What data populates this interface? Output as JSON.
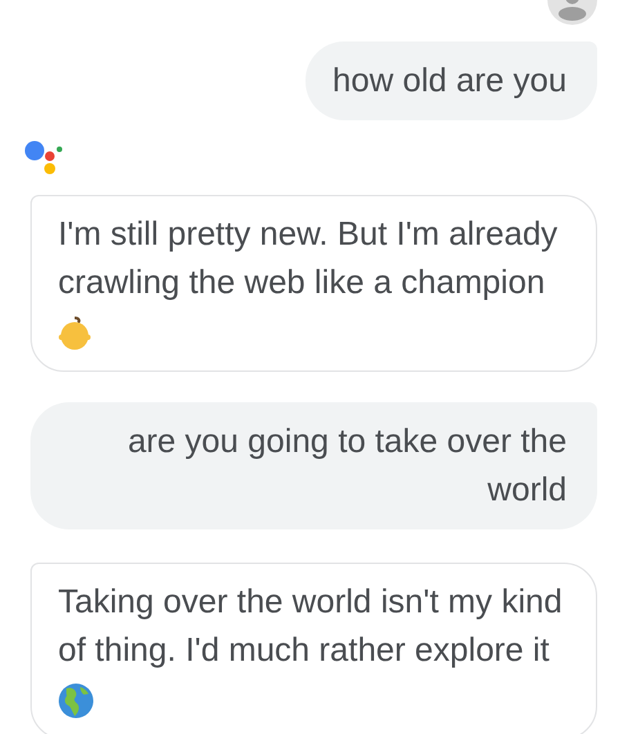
{
  "messages": [
    {
      "kind": "user",
      "text": "how old are you"
    },
    {
      "kind": "assistant",
      "text": "I'm still pretty new. But I'm already crawling the web like a champion"
    },
    {
      "kind": "user",
      "text": "are you going to take over the world"
    },
    {
      "kind": "assistant",
      "text": "Taking over the world isn't my kind of thing. I'd much rather explore it"
    }
  ]
}
